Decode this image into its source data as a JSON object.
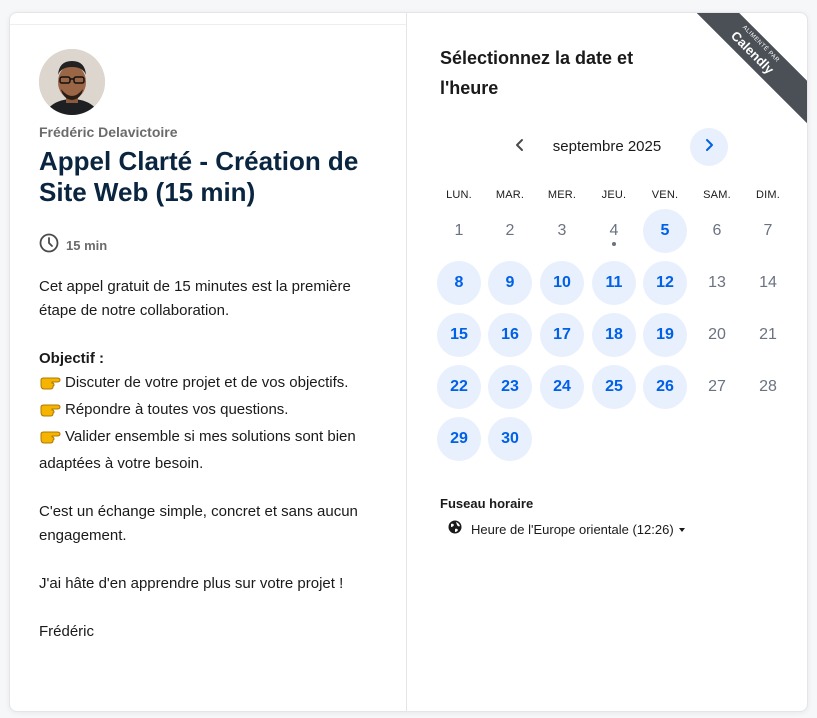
{
  "host": {
    "name": "Frédéric Delavictoire"
  },
  "event": {
    "title": "Appel Clarté - Création de Site Web (15 min)",
    "duration": "15 min",
    "description": {
      "intro": "Cet appel gratuit de 15 minutes est la première étape de notre collaboration.",
      "objective_label": "Objectif :",
      "points": [
        "Discuter de votre projet et de vos objectifs.",
        "Répondre à toutes vos questions.",
        "Valider ensemble si mes solutions sont bien adaptées à votre besoin."
      ],
      "simple": "C'est un échange simple, concret et sans aucun engagement.",
      "closing": "J'ai hâte d'en apprendre plus sur votre projet !",
      "signature": "Frédéric"
    }
  },
  "calendar": {
    "heading": "Sélectionnez la date et l'heure",
    "month_label": "septembre 2025",
    "weekdays": [
      "LUN.",
      "MAR.",
      "MER.",
      "JEU.",
      "VEN.",
      "SAM.",
      "DIM."
    ],
    "weeks": [
      [
        {
          "d": "1",
          "a": false
        },
        {
          "d": "2",
          "a": false
        },
        {
          "d": "3",
          "a": false
        },
        {
          "d": "4",
          "a": false,
          "today": true
        },
        {
          "d": "5",
          "a": true
        },
        {
          "d": "6",
          "a": false
        },
        {
          "d": "7",
          "a": false
        }
      ],
      [
        {
          "d": "8",
          "a": true
        },
        {
          "d": "9",
          "a": true
        },
        {
          "d": "10",
          "a": true
        },
        {
          "d": "11",
          "a": true
        },
        {
          "d": "12",
          "a": true
        },
        {
          "d": "13",
          "a": false
        },
        {
          "d": "14",
          "a": false
        }
      ],
      [
        {
          "d": "15",
          "a": true
        },
        {
          "d": "16",
          "a": true
        },
        {
          "d": "17",
          "a": true
        },
        {
          "d": "18",
          "a": true
        },
        {
          "d": "19",
          "a": true
        },
        {
          "d": "20",
          "a": false
        },
        {
          "d": "21",
          "a": false
        }
      ],
      [
        {
          "d": "22",
          "a": true
        },
        {
          "d": "23",
          "a": true
        },
        {
          "d": "24",
          "a": true
        },
        {
          "d": "25",
          "a": true
        },
        {
          "d": "26",
          "a": true
        },
        {
          "d": "27",
          "a": false
        },
        {
          "d": "28",
          "a": false
        }
      ],
      [
        {
          "d": "29",
          "a": true
        },
        {
          "d": "30",
          "a": true
        }
      ]
    ]
  },
  "timezone": {
    "label": "Fuseau horaire",
    "value": "Heure de l'Europe orientale (12:26)"
  },
  "badge": {
    "line1": "ALIMENTÉ PAR",
    "brand": "Calendly"
  },
  "icons": {
    "clock": "clock-icon",
    "globe": "globe-icon",
    "prev": "chevron-left-icon",
    "next": "chevron-right-icon",
    "pointing": "backhand-index-pointing-right-icon"
  },
  "colors": {
    "accent": "#0060e6",
    "available_bg": "#e8f0fd",
    "title": "#0a2540",
    "ribbon": "#4a5056"
  }
}
